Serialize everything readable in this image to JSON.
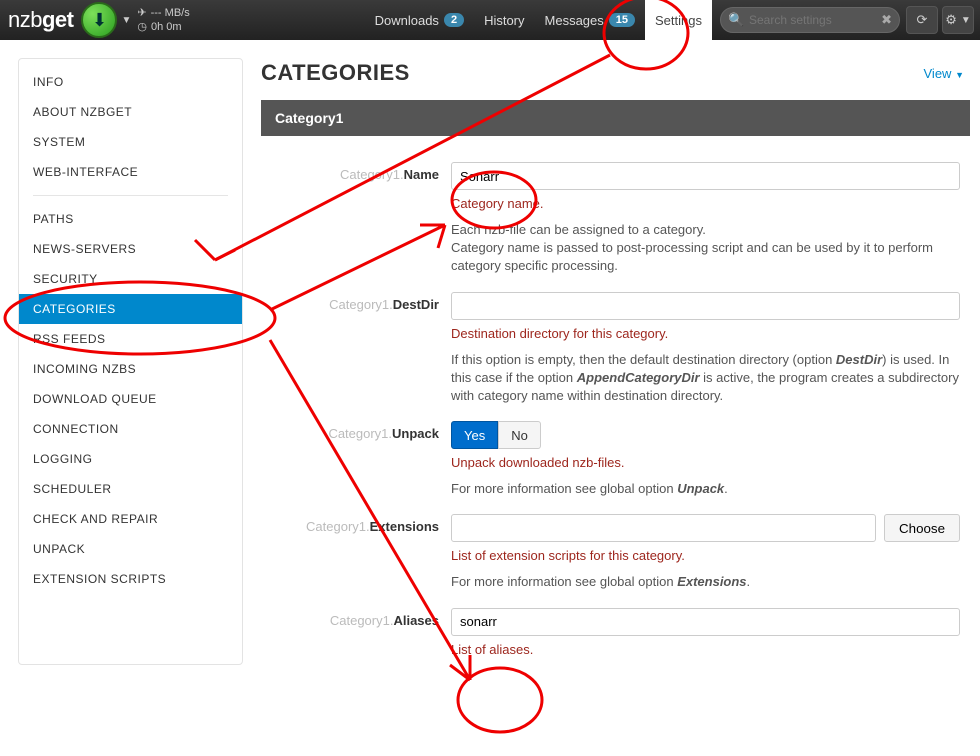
{
  "topbar": {
    "logo_a": "nzb",
    "logo_b": "get",
    "speed_value": "--- MB/s",
    "time_value": "0h 0m",
    "nav": {
      "downloads": "Downloads",
      "downloads_badge": "2",
      "history": "History",
      "messages": "Messages",
      "messages_badge": "15",
      "settings": "Settings"
    },
    "search_placeholder": "Search settings"
  },
  "sidebar": {
    "group1": [
      "INFO",
      "ABOUT NZBGET",
      "SYSTEM",
      "WEB-INTERFACE"
    ],
    "group2": [
      "PATHS",
      "NEWS-SERVERS",
      "SECURITY",
      "CATEGORIES",
      "RSS FEEDS",
      "INCOMING NZBS",
      "DOWNLOAD QUEUE",
      "CONNECTION",
      "LOGGING",
      "SCHEDULER",
      "CHECK AND REPAIR",
      "UNPACK",
      "EXTENSION SCRIPTS"
    ],
    "active": "CATEGORIES"
  },
  "page": {
    "title": "CATEGORIES",
    "view": "View",
    "section": "Category1",
    "fields": {
      "prefix": "Category1.",
      "name_label": "Name",
      "name_value": "Sonarr",
      "name_help": "Category name.",
      "name_desc": "Each nzb-file can be assigned to a category.\nCategory name is passed to post-processing script and can be used by it to perform category specific processing.",
      "destdir_label": "DestDir",
      "destdir_value": "",
      "destdir_help": "Destination directory for this category.",
      "destdir_desc1": "If this option is empty, then the default destination directory (option ",
      "destdir_desc_b1": "DestDir",
      "destdir_desc2": ") is used. In this case if the option ",
      "destdir_desc_b2": "AppendCategoryDir",
      "destdir_desc3": " is active, the program creates a subdirectory with category name within destination directory.",
      "unpack_label": "Unpack",
      "unpack_yes": "Yes",
      "unpack_no": "No",
      "unpack_help": "Unpack downloaded nzb-files.",
      "unpack_desc1": "For more information see global option ",
      "unpack_desc_b": "Unpack",
      "unpack_desc2": ".",
      "ext_label": "Extensions",
      "ext_value": "",
      "choose": "Choose",
      "ext_help": "List of extension scripts for this category.",
      "ext_desc1": "For more information see global option ",
      "ext_desc_b": "Extensions",
      "ext_desc2": ".",
      "aliases_label": "Aliases",
      "aliases_value": "sonarr",
      "aliases_help": "List of aliases."
    }
  }
}
